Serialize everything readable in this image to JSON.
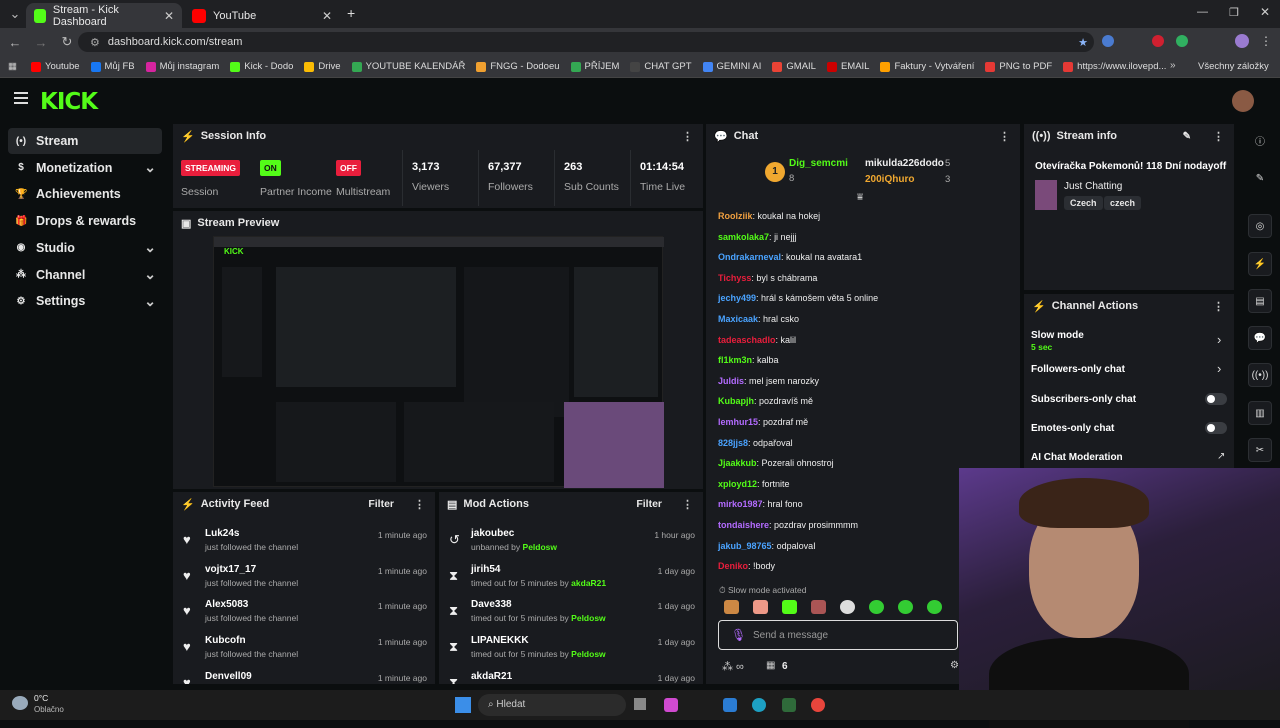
{
  "browser": {
    "tabs": [
      {
        "label": "Stream - Kick Dashboard"
      },
      {
        "label": "YouTube"
      }
    ],
    "url": "dashboard.kick.com/stream",
    "bookmarks": [
      {
        "label": "Youtube",
        "color": "#ff0000"
      },
      {
        "label": "Můj FB",
        "color": "#1877f2"
      },
      {
        "label": "Můj instagram",
        "color": "#d6249f"
      },
      {
        "label": "Kick - Dodo",
        "color": "#53fc18"
      },
      {
        "label": "Drive",
        "color": "#fbbc04"
      },
      {
        "label": "YOUTUBE KALENDÁŘ",
        "color": "#34a853"
      },
      {
        "label": "FNGG - Dodoeu",
        "color": "#f0a030"
      },
      {
        "label": "PŘÍJEM",
        "color": "#34a853"
      },
      {
        "label": "CHAT GPT",
        "color": "#444"
      },
      {
        "label": "GEMINI AI",
        "color": "#4285f4"
      },
      {
        "label": "GMAIL",
        "color": "#ea4335"
      },
      {
        "label": "EMAIL",
        "color": "#c00"
      },
      {
        "label": "Faktury - Vytváření",
        "color": "#ffa000"
      },
      {
        "label": "PNG to PDF",
        "color": "#e53935"
      },
      {
        "label": "https://www.ilovepd...",
        "color": "#e53935"
      }
    ],
    "all_bookmarks": "Všechny záložky"
  },
  "nav": {
    "logo": "KICK",
    "items": [
      {
        "label": "Stream",
        "icon": "stream-icon",
        "chev": ""
      },
      {
        "label": "Monetization",
        "icon": "dollar-icon",
        "chev": "▼"
      },
      {
        "label": "Achievements",
        "icon": "trophy-icon",
        "chev": ""
      },
      {
        "label": "Drops & rewards",
        "icon": "gift-icon",
        "chev": ""
      },
      {
        "label": "Studio",
        "icon": "studio-icon",
        "chev": "▼"
      },
      {
        "label": "Channel",
        "icon": "channel-icon",
        "chev": "▼"
      },
      {
        "label": "Settings",
        "icon": "gear-icon",
        "chev": "▼"
      }
    ]
  },
  "session": {
    "title": "Session Info",
    "badges": [
      {
        "badge": "STREAMING",
        "label": "Session",
        "bg": "#e91e3c"
      },
      {
        "badge": "ON",
        "label": "Partner Income",
        "bg": "#53fc18"
      },
      {
        "badge": "OFF",
        "label": "Multistream",
        "bg": "#e91e3c"
      }
    ],
    "stats": [
      {
        "value": "3,173",
        "label": "Viewers"
      },
      {
        "value": "67,377",
        "label": "Followers"
      },
      {
        "value": "263",
        "label": "Sub Counts"
      },
      {
        "value": "01:14:54",
        "label": "Time Live"
      }
    ]
  },
  "preview": {
    "title": "Stream Preview"
  },
  "activity": {
    "title": "Activity Feed",
    "filter": "Filter",
    "rows": [
      {
        "name": "Luk24s",
        "sub": "just followed the channel",
        "time": "1 minute ago"
      },
      {
        "name": "vojtx17_17",
        "sub": "just followed the channel",
        "time": "1 minute ago"
      },
      {
        "name": "Alex5083",
        "sub": "just followed the channel",
        "time": "1 minute ago"
      },
      {
        "name": "Kubcofn",
        "sub": "just followed the channel",
        "time": "1 minute ago"
      },
      {
        "name": "Denvell09",
        "sub": "",
        "time": "1 minute ago"
      }
    ]
  },
  "mod": {
    "title": "Mod Actions",
    "filter": "Filter",
    "rows": [
      {
        "name": "jakoubec",
        "action": "unbanned by ",
        "by": "Peldosw",
        "time": "1 hour ago"
      },
      {
        "name": "jirih54",
        "action": "timed out for 5 minutes by ",
        "by": "akdaR21",
        "time": "1 day ago"
      },
      {
        "name": "Dave338",
        "action": "timed out for 5 minutes by ",
        "by": "Peldosw",
        "time": "1 day ago"
      },
      {
        "name": "LIPANEKKK",
        "action": "timed out for 5 minutes by ",
        "by": "Peldosw",
        "time": "1 day ago"
      },
      {
        "name": "akdaR21",
        "action": "",
        "by": "",
        "time": "1 day ago"
      }
    ]
  },
  "chat": {
    "title": "Chat",
    "top": [
      {
        "name": "Dig_semcmi",
        "count": "8"
      },
      {
        "name": "mikulda226dodo",
        "count": "5"
      },
      {
        "name": "200iQhuro",
        "count": "3"
      }
    ],
    "messages": [
      {
        "user": "Roolziik",
        "color": "#f0a040",
        "text": "koukal na hokej"
      },
      {
        "user": "samkolaka7",
        "color": "#53fc18",
        "text": "ji nejjj"
      },
      {
        "user": "Ondrakarneval",
        "color": "#4aa3ff",
        "text": "koukal na avatara1"
      },
      {
        "user": "Tichyss",
        "color": "#e91e3c",
        "text": "byl s chábrama"
      },
      {
        "user": "jechy499",
        "color": "#4aa3ff",
        "text": "hrál s kámošem věta 5 online"
      },
      {
        "user": "Maxicaak",
        "color": "#4aa3ff",
        "text": "hral csko"
      },
      {
        "user": "tadeaschadlo",
        "color": "#e91e3c",
        "text": "kalil"
      },
      {
        "user": "fl1km3n",
        "color": "#53fc18",
        "text": "kalba"
      },
      {
        "user": "Juldis",
        "color": "#b36bff",
        "text": "mel jsem narozky"
      },
      {
        "user": "Kubapjh",
        "color": "#53fc18",
        "text": "pozdravíš mě"
      },
      {
        "user": "lemhur15",
        "color": "#b36bff",
        "text": "pozdraf mě"
      },
      {
        "user": "828jjs8",
        "color": "#4aa3ff",
        "text": "odpařoval"
      },
      {
        "user": "Jjaakkub",
        "color": "#53fc18",
        "text": "Pozerali ohnostroj"
      },
      {
        "user": "xployd12",
        "color": "#53fc18",
        "text": "fortnite"
      },
      {
        "user": "mirko1987",
        "color": "#b36bff",
        "text": "hral fono"
      },
      {
        "user": "tondaishere",
        "color": "#b36bff",
        "text": "pozdrav prosimmmm"
      },
      {
        "user": "jakub_98765",
        "color": "#4aa3ff",
        "text": "odpalovaI"
      },
      {
        "user": "Deniko",
        "color": "#e91e3c",
        "text": "!body"
      }
    ],
    "slow_notice": "Slow mode activated",
    "placeholder": "Send a message",
    "count": "6"
  },
  "stream_info": {
    "title": "Stream info",
    "stream_title": "Otevíračka Pokemonů! 118 Dní nodayoff",
    "category": "Just Chatting",
    "tags": [
      "Czech",
      "czech"
    ]
  },
  "channel_actions": {
    "title": "Channel Actions",
    "rows": [
      {
        "label": "Slow mode",
        "sub": "5 sec"
      },
      {
        "label": "Followers-only chat",
        "sub": ""
      },
      {
        "label": "Subscribers-only chat",
        "sub": ""
      },
      {
        "label": "Emotes-only chat",
        "sub": ""
      },
      {
        "label": "AI Chat Moderation",
        "sub": ""
      }
    ]
  },
  "taskbar": {
    "temp": "0°C",
    "weather": "Oblačno",
    "search": "Hledat"
  }
}
